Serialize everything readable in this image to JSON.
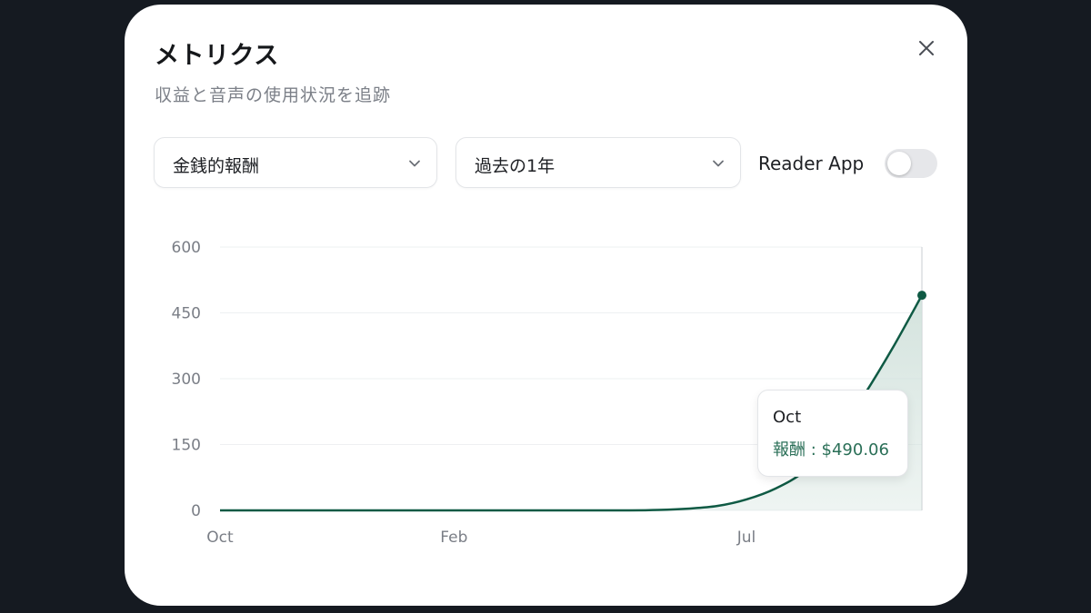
{
  "modal": {
    "title": "メトリクス",
    "subtitle": "収益と音声の使用状況を追跡"
  },
  "filters": {
    "metric_select": "金銭的報酬",
    "period_select": "過去の1年",
    "reader_app_label": "Reader App",
    "reader_app_enabled": false
  },
  "icons": {
    "close": "close-icon",
    "chevron": "chevron-down-icon"
  },
  "colors": {
    "line": "#0f5a44",
    "area": "#cfe0da",
    "toggle_off": "#e6e7ea",
    "tooltip_value": "#2a6f57"
  },
  "tooltip": {
    "title": "Oct",
    "value": "報酬 : $490.06"
  },
  "chart_data": {
    "type": "area",
    "x_ticks": [
      "Oct",
      "Feb",
      "Jul"
    ],
    "y_ticks": [
      0,
      150,
      300,
      450,
      600
    ],
    "ylim": [
      0,
      600
    ],
    "grid": true,
    "series": [
      {
        "x": [
          0,
          1,
          2,
          3,
          4,
          5,
          6,
          7,
          7.5,
          8,
          8.5,
          9,
          9.5,
          10,
          10.5,
          11,
          11.5,
          12
        ],
        "values": [
          0,
          0,
          0,
          0,
          0,
          0,
          0,
          0,
          1,
          4,
          10,
          25,
          50,
          90,
          160,
          260,
          370,
          490.06
        ]
      }
    ]
  }
}
